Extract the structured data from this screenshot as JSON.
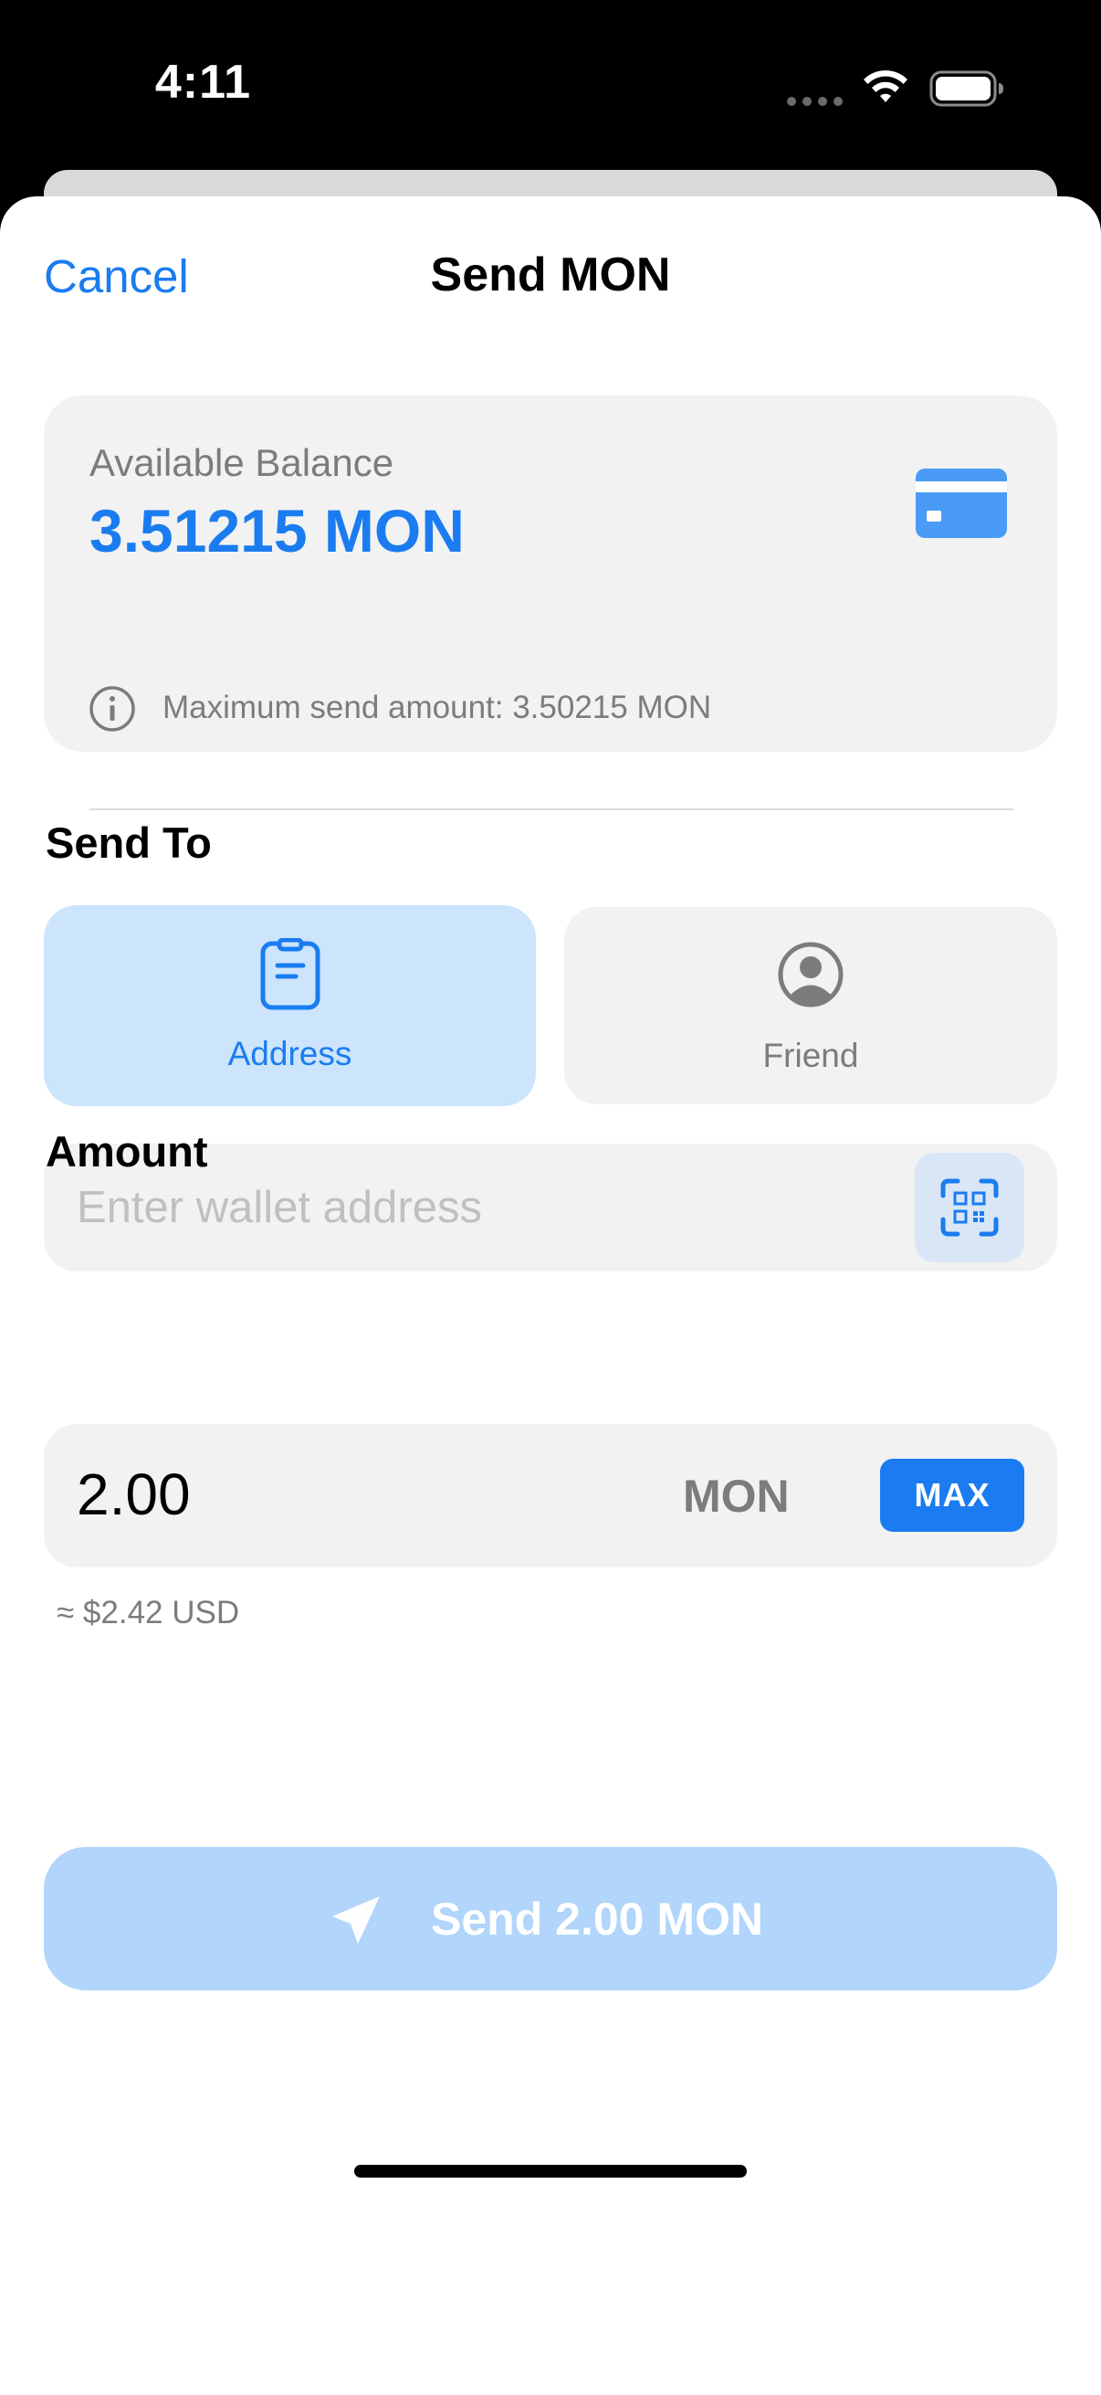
{
  "status_bar": {
    "time": "4:11",
    "icons": [
      "cellular-dots-icon",
      "wifi-icon",
      "battery-icon"
    ]
  },
  "nav": {
    "cancel_label": "Cancel",
    "title": "Send MON"
  },
  "balance": {
    "label": "Available Balance",
    "amount": "3.51215 MON",
    "icon": "credit-card-icon",
    "max_send_text": "Maximum send amount: 3.50215 MON"
  },
  "send_to": {
    "label": "Send To",
    "options": [
      {
        "label": "Address",
        "icon": "clipboard-icon",
        "selected": true
      },
      {
        "label": "Friend",
        "icon": "person-circle-icon",
        "selected": false
      }
    ],
    "address_placeholder": "Enter wallet address",
    "address_value": ""
  },
  "amount": {
    "label": "Amount",
    "value": "2.00",
    "unit": "MON",
    "max_label": "MAX",
    "usd_estimate": "≈ $2.42 USD"
  },
  "send_button": {
    "label": "Send 2.00 MON",
    "icon": "paper-plane-icon",
    "enabled": false
  },
  "colors": {
    "accent": "#1a7cf0",
    "accent_light": "#cde4fd",
    "disabled_button": "#b1d5fb",
    "card_bg": "#f2f2f2",
    "secondary_text": "#7c7c7c"
  }
}
